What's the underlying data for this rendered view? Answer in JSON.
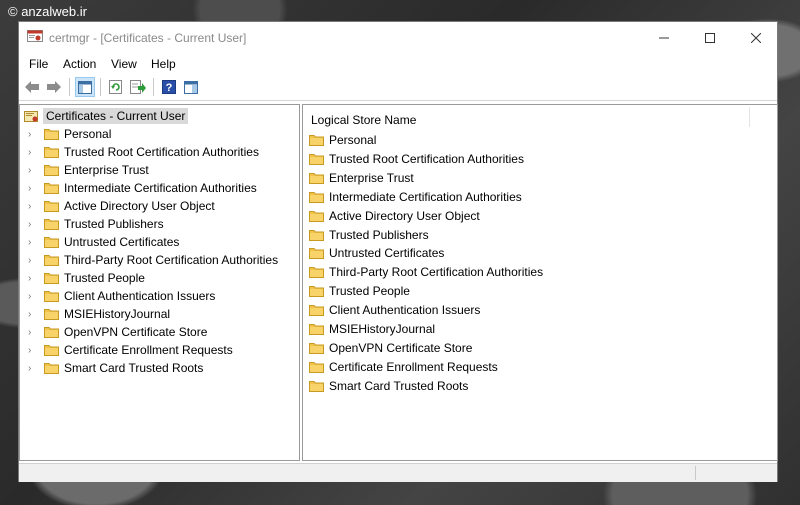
{
  "watermark": "© anzalweb.ir",
  "window": {
    "title": "certmgr - [Certificates - Current User]"
  },
  "menu": [
    "File",
    "Action",
    "View",
    "Help"
  ],
  "toolbar": {
    "buttons": [
      "back-arrow-icon",
      "forward-arrow-icon",
      "show-hide-tree-icon",
      "refresh-icon",
      "export-list-icon",
      "help-icon",
      "properties-icon"
    ]
  },
  "tree": {
    "root": "Certificates - Current User",
    "items": [
      "Personal",
      "Trusted Root Certification Authorities",
      "Enterprise Trust",
      "Intermediate Certification Authorities",
      "Active Directory User Object",
      "Trusted Publishers",
      "Untrusted Certificates",
      "Third-Party Root Certification Authorities",
      "Trusted People",
      "Client Authentication Issuers",
      "MSIEHistoryJournal",
      "OpenVPN Certificate Store",
      "Certificate Enrollment Requests",
      "Smart Card Trusted Roots"
    ]
  },
  "list": {
    "column": "Logical Store Name",
    "items": [
      "Personal",
      "Trusted Root Certification Authorities",
      "Enterprise Trust",
      "Intermediate Certification Authorities",
      "Active Directory User Object",
      "Trusted Publishers",
      "Untrusted Certificates",
      "Third-Party Root Certification Authorities",
      "Trusted People",
      "Client Authentication Issuers",
      "MSIEHistoryJournal",
      "OpenVPN Certificate Store",
      "Certificate Enrollment Requests",
      "Smart Card Trusted Roots"
    ]
  },
  "colors": {
    "folder": "#f0c44a",
    "selection": "#d9d9d9",
    "title_text": "#8a8a8a"
  }
}
